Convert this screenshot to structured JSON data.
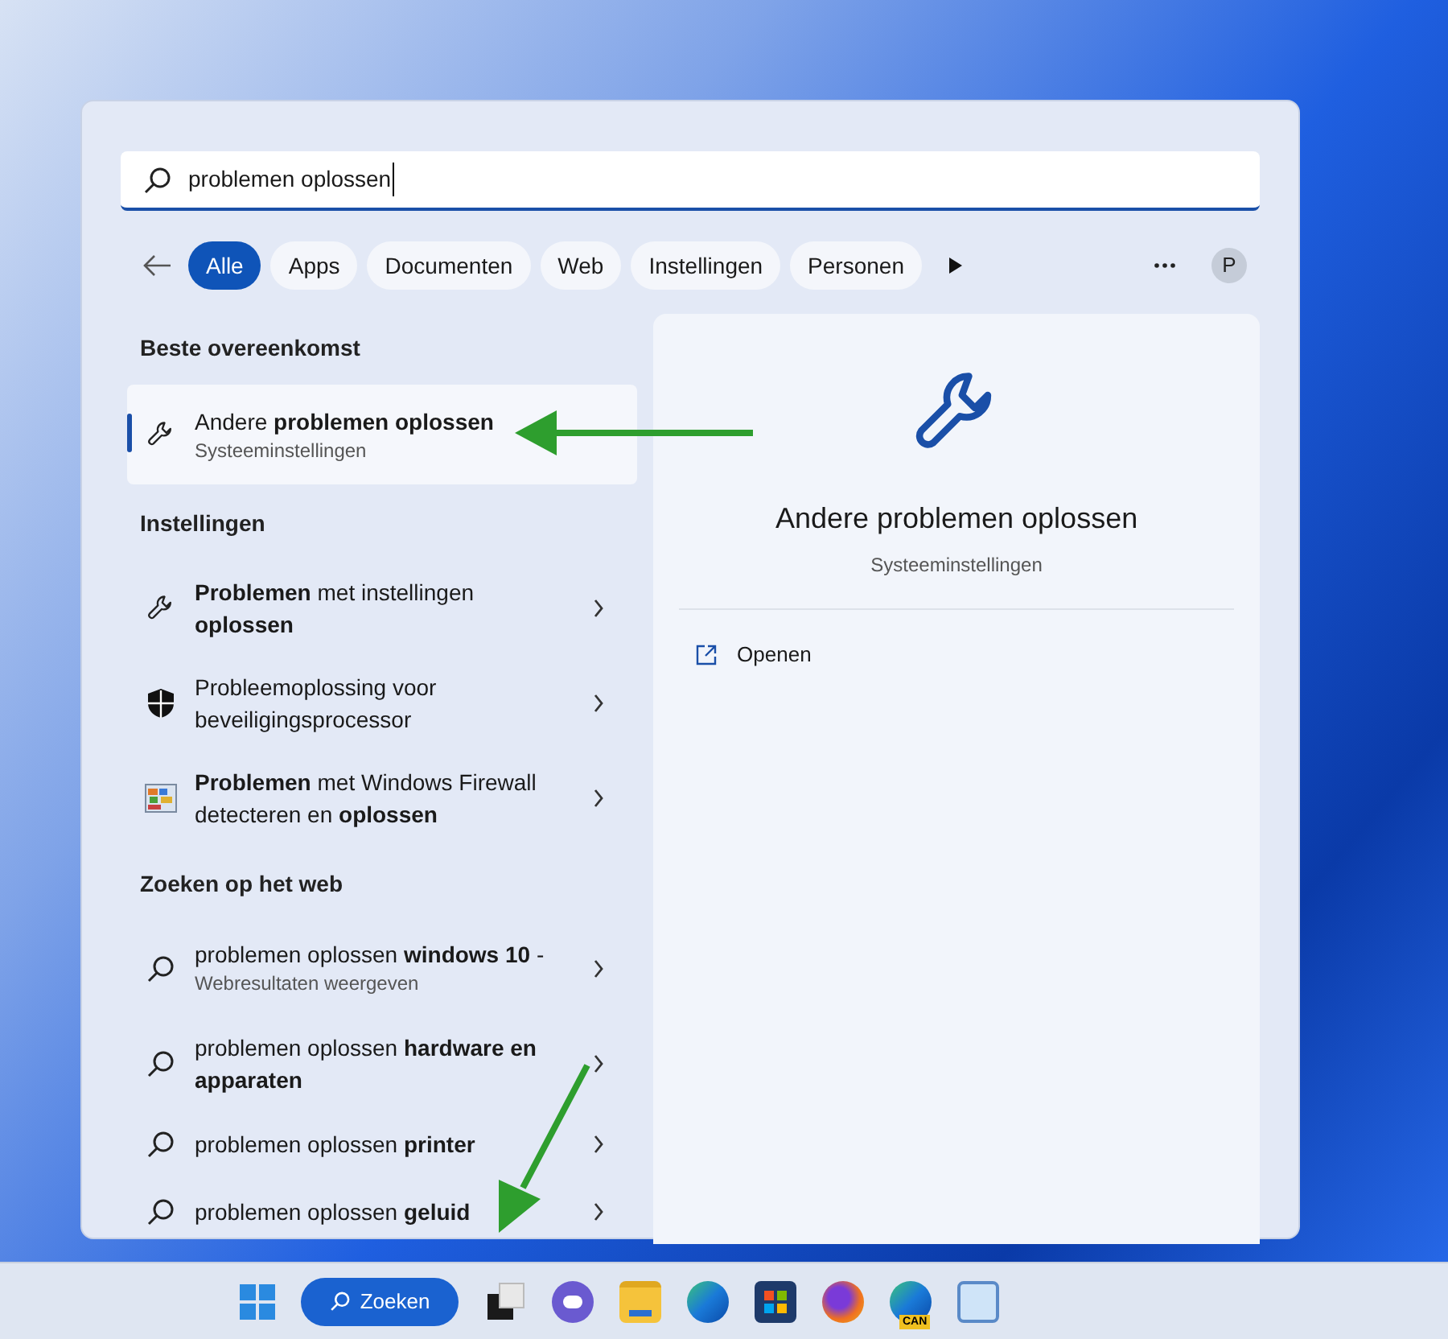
{
  "search": {
    "value": "problemen oplossen"
  },
  "filters": [
    {
      "label": "Alle",
      "selected": true
    },
    {
      "label": "Apps",
      "selected": false
    },
    {
      "label": "Documenten",
      "selected": false
    },
    {
      "label": "Web",
      "selected": false
    },
    {
      "label": "Instellingen",
      "selected": false
    },
    {
      "label": "Personen",
      "selected": false
    }
  ],
  "account": {
    "initial": "P"
  },
  "sections": [
    {
      "heading": "Beste overeenkomst",
      "items": [
        {
          "kind": "match",
          "title": "Andere **problemen oplossen**",
          "subtitle": "Systeeminstellingen",
          "selected": true
        }
      ]
    },
    {
      "heading": "Instellingen",
      "items": [
        {
          "kind": "setting",
          "title": "**Problemen** met instellingen **oplossen**",
          "selected": false
        },
        {
          "kind": "security",
          "title": "Probleemoplossing voor beveiligingsprocessor",
          "selected": false
        },
        {
          "kind": "firewall",
          "title": "**Problemen** met Windows Firewall detecteren en **oplossen**",
          "selected": false
        }
      ]
    },
    {
      "heading": "Zoeken op het web",
      "items": [
        {
          "kind": "web",
          "title": "problemen oplossen **windows 10** -",
          "subtitle": "Webresultaten weergeven",
          "selected": false
        },
        {
          "kind": "web",
          "title": "problemen oplossen **hardware en apparaten**",
          "selected": false
        },
        {
          "kind": "web",
          "title": "problemen oplossen **printer**",
          "selected": false
        },
        {
          "kind": "web",
          "title": "problemen oplossen **geluid**",
          "selected": false
        }
      ]
    }
  ],
  "detail": {
    "title": "Andere problemen oplossen",
    "subtitle": "Systeeminstellingen",
    "actions": [
      {
        "label": "Openen"
      }
    ]
  },
  "taskbar": {
    "search_label": "Zoeken",
    "apps": [
      {
        "kind": "taskview"
      },
      {
        "kind": "chat"
      },
      {
        "kind": "folder"
      },
      {
        "kind": "edge"
      },
      {
        "kind": "store"
      },
      {
        "kind": "firefox"
      },
      {
        "kind": "edge",
        "badge": "CAN"
      },
      {
        "kind": "monitor"
      }
    ]
  }
}
